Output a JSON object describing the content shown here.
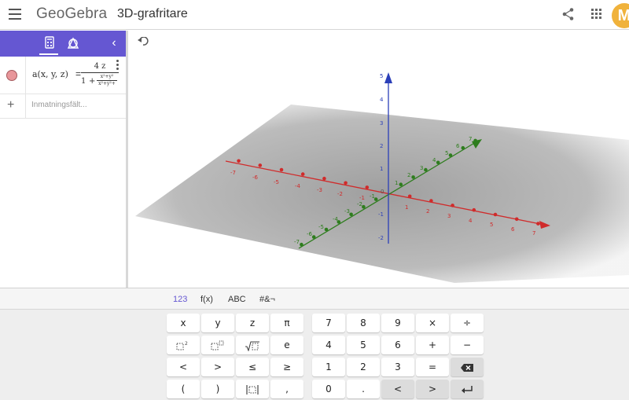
{
  "header": {
    "logo": "GeoGebra",
    "title": "3D-grafritare",
    "avatar_initial": "M",
    "avatar_color": "#f0b23b"
  },
  "algebra": {
    "accent_color": "#6557d2",
    "tabs": [
      "calculator-icon",
      "tools-icon"
    ],
    "expression": {
      "lhs": "a(x, y, z)",
      "equals": "=",
      "numerator": "4 z",
      "denominator_one": "1",
      "denominator_plus": "+",
      "mini_numerator": "x²+y²",
      "mini_denominator": "x²+y²+"
    },
    "input_placeholder": "Inmatningsfält..."
  },
  "graphics": {
    "z_ticks": [
      "5",
      "4",
      "3",
      "2",
      "1",
      "-1",
      "-2"
    ],
    "x_neg_ticks": [
      "-7",
      "-6",
      "-5",
      "-4",
      "-3",
      "-2",
      "-1"
    ],
    "x_pos_ticks": [
      "1",
      "2",
      "3",
      "4",
      "5",
      "6",
      "7"
    ],
    "y_neg_ticks": [
      "-7",
      "-6",
      "-5",
      "-4",
      "-3",
      "-2",
      "-1"
    ],
    "y_pos_ticks": [
      "1",
      "2",
      "3",
      "4",
      "5",
      "6",
      "7"
    ],
    "origin": "0",
    "colors": {
      "x_axis": "#d02b2b",
      "y_axis": "#2e7d1e",
      "z_axis": "#2b3fb8",
      "plane": "#b0b0b0"
    }
  },
  "keyboard": {
    "tabs": [
      "123",
      "f(x)",
      "ABC",
      "#&¬"
    ],
    "active_tab": "123",
    "rows": [
      [
        "x",
        "y",
        "z",
        "π",
        "7",
        "8",
        "9",
        "×",
        "÷"
      ],
      [
        "x²",
        "xⁿ",
        "√x",
        "e",
        "4",
        "5",
        "6",
        "+",
        "−"
      ],
      [
        "<",
        ">",
        "≤",
        "≥",
        "1",
        "2",
        "3",
        "=",
        "backspace-icon"
      ],
      [
        "(",
        ")",
        "|x|",
        ",",
        "0",
        ".",
        "<",
        ">",
        "enter-icon"
      ]
    ]
  }
}
